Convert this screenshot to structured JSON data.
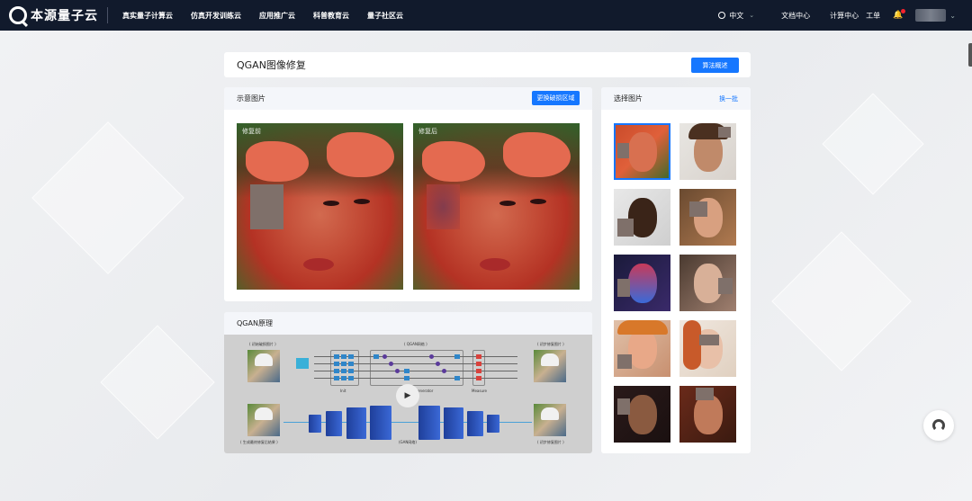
{
  "nav": {
    "brand": "本源量子云",
    "links": [
      "真实量子计算云",
      "仿真开发训练云",
      "应用推广云",
      "科普教育云",
      "量子社区云"
    ],
    "language": "中文",
    "doc_center": "文档中心",
    "compute_center": "计算中心",
    "tickets": "工单",
    "icons": {
      "language": "globe-icon",
      "bell": "bell-icon",
      "chevron": "chevron-down-icon"
    }
  },
  "header": {
    "title": "QGAN图像修复",
    "algo_button": "算法概述"
  },
  "demo": {
    "title": "示意图片",
    "replace_button": "更换破损区域",
    "before_label": "修复前",
    "after_label": "修复后"
  },
  "principle": {
    "title": "QGAN原理",
    "captions": {
      "input": "( 初始破损图片 )",
      "qgan_net": "( QGAN网络 )",
      "initial_repair_top": "( 初步修复图片 )",
      "init": "Init",
      "generator": "Generator",
      "measure": "Measure",
      "final": "( 生成最终修复后结果 )",
      "gan_net": "(GAN网络)",
      "initial_repair_bottom": "( 初步修复图片 )"
    }
  },
  "choose": {
    "title": "选择图片",
    "swap_link": "换一批",
    "selected_index": 0
  },
  "colors": {
    "nav_bg": "#111a2c",
    "accent": "#1677ff",
    "mask": "#7f706a"
  }
}
